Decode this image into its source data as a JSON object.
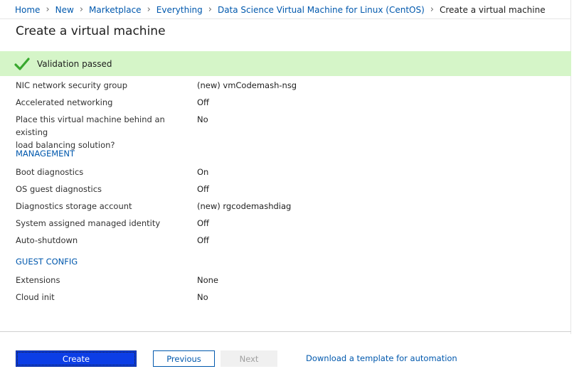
{
  "breadcrumb": {
    "items": [
      "Home",
      "Marketplace",
      "Everything",
      "Data Science Virtual Machine for Linux (CentOS)"
    ],
    "new_label": "New",
    "current": "Create a virtual machine"
  },
  "page_title": "Create a virtual machine",
  "validation": {
    "text": "Validation passed",
    "color": "#d5f5c8",
    "icon": "checkmark-icon"
  },
  "networking": {
    "nsg": {
      "label": "NIC network security group",
      "value": "(new) vmCodemash-nsg"
    },
    "accel": {
      "label": "Accelerated networking",
      "value": "Off"
    },
    "lb": {
      "label_line1": "Place this virtual machine behind an existing",
      "label_line2": "load balancing solution?",
      "value": "No"
    }
  },
  "management": {
    "heading": "MANAGEMENT",
    "boot": {
      "label": "Boot diagnostics",
      "value": "On"
    },
    "osdiag": {
      "label": "OS guest diagnostics",
      "value": "Off"
    },
    "storage": {
      "label": "Diagnostics storage account",
      "value": "(new) rgcodemashdiag"
    },
    "identity": {
      "label": "System assigned managed identity",
      "value": "Off"
    },
    "shutdown": {
      "label": "Auto-shutdown",
      "value": "Off"
    }
  },
  "guest_config": {
    "heading": "GUEST CONFIG",
    "extensions": {
      "label": "Extensions",
      "value": "None"
    },
    "cloudinit": {
      "label": "Cloud init",
      "value": "No"
    }
  },
  "footer": {
    "create_label": "Create",
    "previous_label": "Previous",
    "next_label": "Next",
    "download_label": "Download a template for automation"
  },
  "colors": {
    "accent": "#0058ad",
    "primary_button": "#0c3ee6",
    "success_bg": "#d5f5c8",
    "success_check": "#38a82e"
  }
}
